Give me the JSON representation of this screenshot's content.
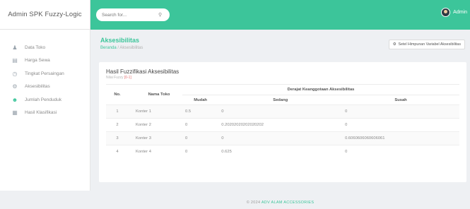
{
  "brand": "Admin SPK Fuzzy-Logic",
  "search": {
    "placeholder": "Search for...",
    "icon": "search-icon"
  },
  "user": {
    "name": "Admin",
    "icon": "avatar"
  },
  "colors": {
    "accent": "#3cc59a",
    "header": "#3cc59a"
  },
  "sidebar": {
    "items": [
      {
        "label": "Data Toko",
        "icon": "user-icon"
      },
      {
        "label": "Harga Sewa",
        "icon": "money-icon"
      },
      {
        "label": "Tingkat Persaingan",
        "icon": "clock-icon"
      },
      {
        "label": "Aksesibilitas",
        "icon": "gear-icon"
      },
      {
        "label": "Jumlah Penduduk",
        "icon": "people-icon"
      },
      {
        "label": "Hasil Klasifikasi",
        "icon": "table-icon"
      }
    ]
  },
  "page": {
    "title": "Aksesibilitas",
    "breadcrumb_home": "Beranda",
    "breadcrumb_sep": "/",
    "breadcrumb_current": "Aksesibilitas",
    "set_button": "Setel Himpunan Variabel Aksesibilitas"
  },
  "card": {
    "title": "Hasil Fuzzifikasi Aksesibilitas",
    "sub_prefix": "Nilai Fuzzy",
    "sub_range": "[0-1]"
  },
  "table": {
    "col_no": "No.",
    "col_nama": "Nama Toko",
    "col_group": "Derajat Keanggotaan Aksesibilitas",
    "sub_cols": [
      "Mudah",
      "Sedang",
      "Susah"
    ],
    "rows": [
      {
        "no": "1",
        "nama": "Konter 1",
        "mudah": "0.5",
        "sedang": "0",
        "susah": "0"
      },
      {
        "no": "2",
        "nama": "Konter 2",
        "mudah": "0",
        "sedang": "0.20202020202020202",
        "susah": "0"
      },
      {
        "no": "3",
        "nama": "Konter 3",
        "mudah": "0",
        "sedang": "0",
        "susah": "0.6060606060606061"
      },
      {
        "no": "4",
        "nama": "Konter 4",
        "mudah": "0",
        "sedang": "0.625",
        "susah": "0"
      }
    ]
  },
  "footer": {
    "text": "© 2024 ",
    "link": "ADV ALAM ACCESSORIES"
  }
}
